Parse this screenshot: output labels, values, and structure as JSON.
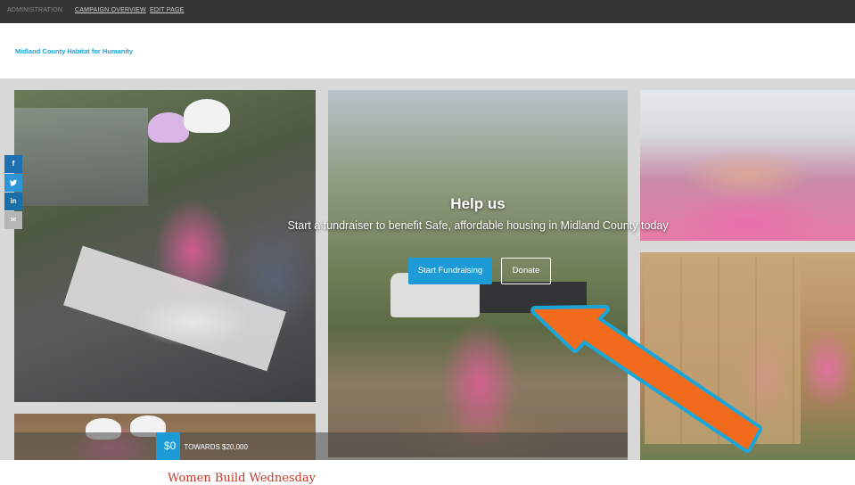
{
  "admin_bar": {
    "administration": "ADMINISTRATION",
    "campaign_overview": "CAMPAIGN OVERVIEW",
    "edit_page": "EDIT PAGE"
  },
  "organization": {
    "name": "Midland County Habitat for Humanity"
  },
  "social": {
    "facebook": "f",
    "twitter": "t",
    "linkedin": "in",
    "email": "✉"
  },
  "hero": {
    "title": "Help us",
    "subtitle": "Start a fundraiser to benefit Safe, affordable housing in Midland County today",
    "start_fundraising": "Start Fundraising",
    "donate": "Donate"
  },
  "progress": {
    "raised": "$0",
    "towards": "TOWARDS $20,000"
  },
  "campaign": {
    "title": "Women Build Wednesday"
  },
  "colors": {
    "accent": "#1d9bd6",
    "arrow_fill": "#f26b1d",
    "arrow_outline": "#19a6d9",
    "title_red": "#c0392b"
  }
}
